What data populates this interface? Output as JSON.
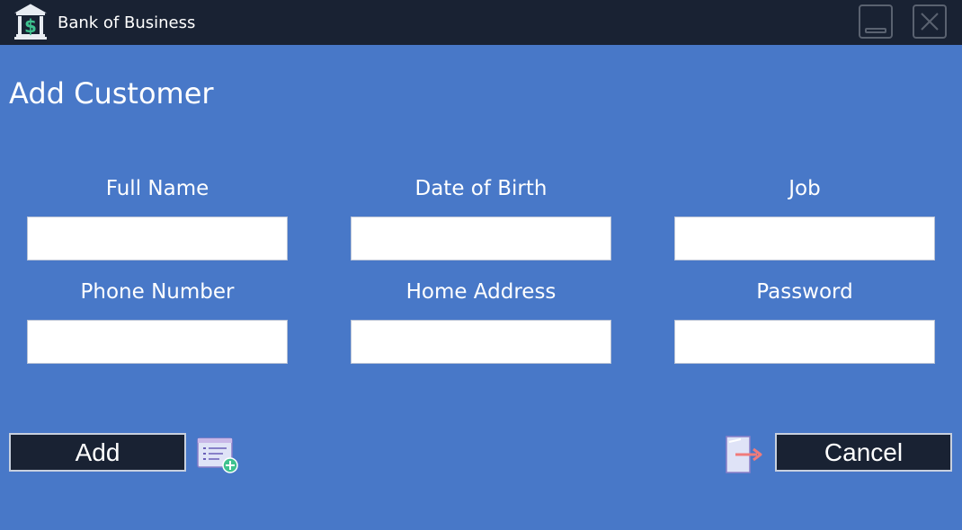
{
  "window": {
    "title": "Bank of Business",
    "app_icon": "bank-dollar-icon",
    "controls": [
      "minimize-icon",
      "close-icon"
    ]
  },
  "page": {
    "heading": "Add Customer"
  },
  "form": {
    "fields": [
      {
        "label": "Full Name",
        "value": "",
        "placeholder": ""
      },
      {
        "label": "Date of Birth",
        "value": "",
        "placeholder": ""
      },
      {
        "label": "Job",
        "value": "",
        "placeholder": ""
      },
      {
        "label": "Phone Number",
        "value": "",
        "placeholder": ""
      },
      {
        "label": "Home Address",
        "value": "",
        "placeholder": ""
      },
      {
        "label": "Password",
        "value": "",
        "placeholder": ""
      }
    ]
  },
  "actions": {
    "add_label": "Add",
    "add_icon": "add-list-icon",
    "cancel_label": "Cancel",
    "cancel_icon": "exit-door-icon"
  },
  "colors": {
    "titlebar": "#192233",
    "background": "#4878c8",
    "button": "#192233",
    "icon_accent": "#3ec28f"
  }
}
